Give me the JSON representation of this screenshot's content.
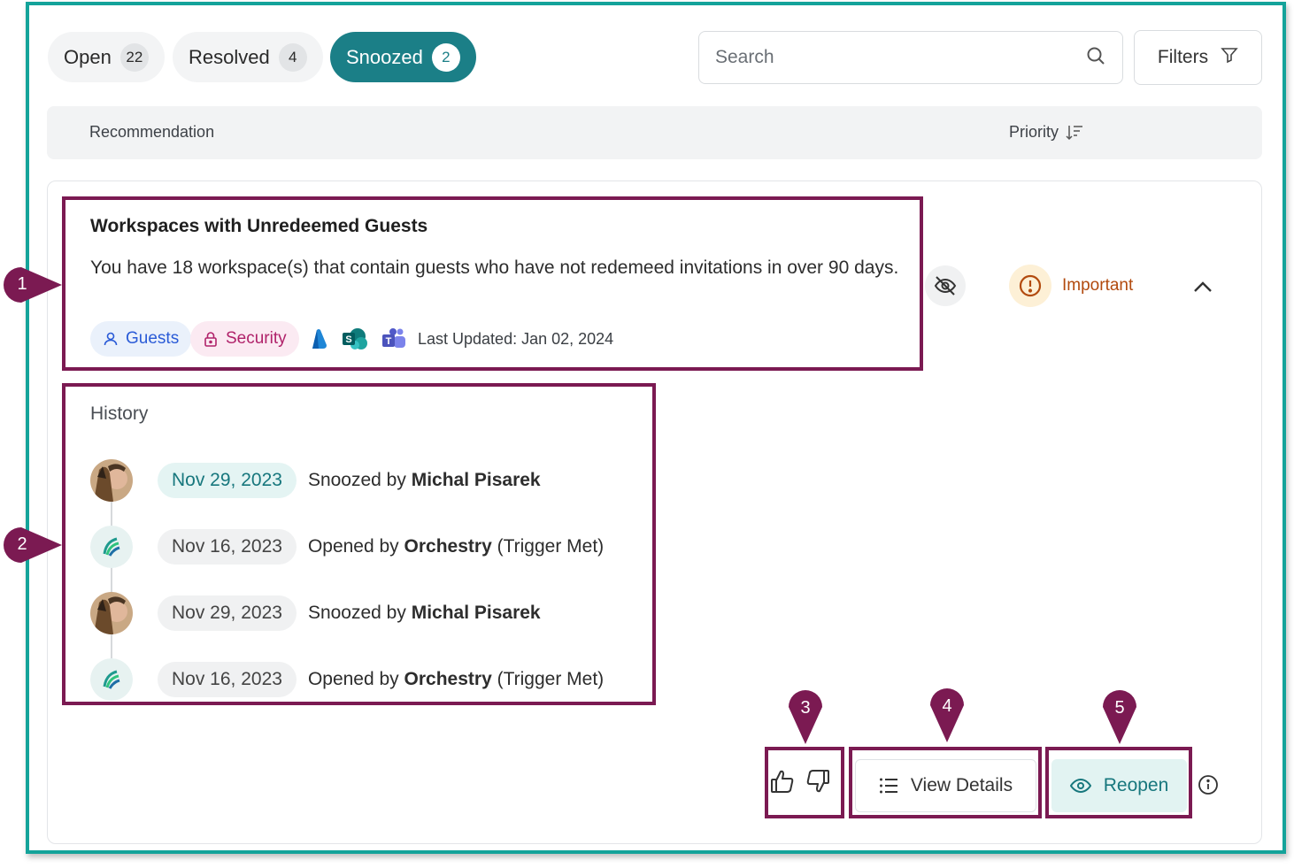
{
  "tabs": [
    {
      "label": "Open",
      "count": "22"
    },
    {
      "label": "Resolved",
      "count": "4"
    },
    {
      "label": "Snoozed",
      "count": "2"
    }
  ],
  "search": {
    "placeholder": "Search"
  },
  "filters": {
    "label": "Filters"
  },
  "table_header": {
    "recommendation": "Recommendation",
    "priority": "Priority"
  },
  "recommendation": {
    "title": "Workspaces with Unredeemed Guests",
    "description": "You have 18 workspace(s) that contain guests who have not redemeed invitations in over 90 days.",
    "tags": [
      "Guests",
      "Security"
    ],
    "apps": [
      "onedrive-icon",
      "sharepoint-icon",
      "teams-icon"
    ],
    "last_updated": "Last Updated: Jan 02, 2024",
    "priority": "Important"
  },
  "history": {
    "title": "History",
    "entries": [
      {
        "date": "Nov 29, 2023",
        "action": "Snoozed by",
        "actor": "Michal Pisarek",
        "suffix": ""
      },
      {
        "date": "Nov 16, 2023",
        "action": "Opened by",
        "actor": "Orchestry",
        "suffix": "(Trigger Met)"
      },
      {
        "date": "Nov 29, 2023",
        "action": "Snoozed by",
        "actor": "Michal Pisarek",
        "suffix": ""
      },
      {
        "date": "Nov 16, 2023",
        "action": "Opened by",
        "actor": "Orchestry",
        "suffix": "(Trigger Met)"
      }
    ]
  },
  "actions": {
    "view_details": "View Details",
    "reopen": "Reopen"
  },
  "markers": [
    "1",
    "2",
    "3",
    "4",
    "5"
  ],
  "colors": {
    "accent": "#1b7f87",
    "frame": "#14a39a",
    "highlight": "#7b1a52",
    "important": "#b24a0e"
  }
}
